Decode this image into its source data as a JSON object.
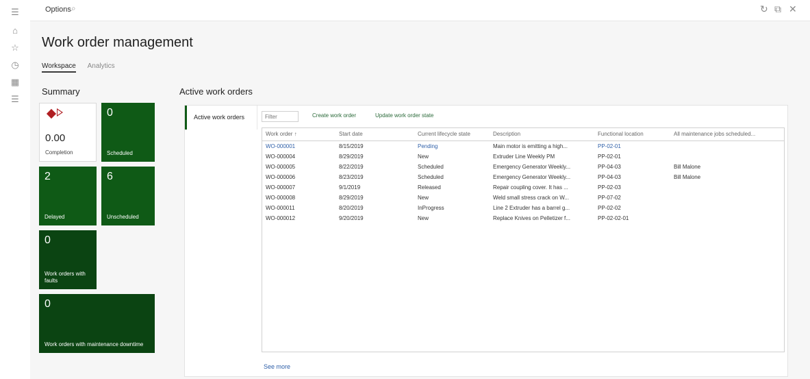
{
  "top_bar": {
    "title": "Options",
    "search_icon": "search-icon",
    "right_icons": [
      "refresh-icon",
      "open-in-new-icon",
      "close-icon"
    ]
  },
  "nav_rail": {
    "icons": [
      "hamburger-menu-icon",
      "home-icon",
      "star-icon",
      "recent-clock-icon",
      "workspaces-icon",
      "modules-list-icon"
    ]
  },
  "page": {
    "title": "Work order management",
    "tabs": [
      {
        "label": "Workspace",
        "active": true
      },
      {
        "label": "Analytics",
        "active": false
      }
    ]
  },
  "summary": {
    "title": "Summary",
    "tiles": {
      "completion": {
        "value": "0.00",
        "label": "Completion"
      },
      "scheduled": {
        "value": "0",
        "label": "Scheduled"
      },
      "delayed": {
        "value": "2",
        "label": "Delayed"
      },
      "unscheduled": {
        "value": "6",
        "label": "Unscheduled"
      },
      "faults": {
        "value": "0",
        "label": "Work orders with faults"
      },
      "downtime": {
        "value": "0",
        "label": "Work orders with maintenance downtime"
      }
    }
  },
  "active_work_orders": {
    "section_title": "Active work orders",
    "side_tab_label": "Active work orders",
    "filter_placeholder": "Filter",
    "actions": {
      "create": "Create work order",
      "update": "Update work order state"
    },
    "columns": [
      "Work order ↑",
      "Start date",
      "Current lifecycle state",
      "Description",
      "Functional location",
      "All maintenance jobs scheduled..."
    ],
    "rows": [
      {
        "work_order": "WO-000001",
        "start_date": "8/15/2019",
        "state": "Pending",
        "description": "Main motor is emitting a high...",
        "location": "PP-02-01",
        "jobs": ""
      },
      {
        "work_order": "WO-000004",
        "start_date": "8/29/2019",
        "state": "New",
        "description": "Extruder Line Weekly PM",
        "location": "PP-02-01",
        "jobs": ""
      },
      {
        "work_order": "WO-000005",
        "start_date": "8/22/2019",
        "state": "Scheduled",
        "description": "Emergency Generator Weekly...",
        "location": "PP-04-03",
        "jobs": "Bill Malone"
      },
      {
        "work_order": "WO-000006",
        "start_date": "8/23/2019",
        "state": "Scheduled",
        "description": "Emergency Generator Weekly...",
        "location": "PP-04-03",
        "jobs": "Bill Malone"
      },
      {
        "work_order": "WO-000007",
        "start_date": "9/1/2019",
        "state": "Released",
        "description": "Repair coupling cover. It has ...",
        "location": "PP-02-03",
        "jobs": ""
      },
      {
        "work_order": "WO-000008",
        "start_date": "8/29/2019",
        "state": "New",
        "description": "Weld small stress crack on W...",
        "location": "PP-07-02",
        "jobs": ""
      },
      {
        "work_order": "WO-000011",
        "start_date": "8/20/2019",
        "state": "InProgress",
        "description": "Line 2 Extruder has a barrel g...",
        "location": "PP-02-02",
        "jobs": ""
      },
      {
        "work_order": "WO-000012",
        "start_date": "9/20/2019",
        "state": "New",
        "description": "Replace Knives on Pelletizer f...",
        "location": "PP-02-02-01",
        "jobs": ""
      }
    ],
    "see_more": "See more"
  },
  "colors": {
    "tile_green": "#0f5a16",
    "tile_dark_green": "#0b4412",
    "link_blue": "#2e5fa8",
    "completion_red": "#b01e22"
  }
}
